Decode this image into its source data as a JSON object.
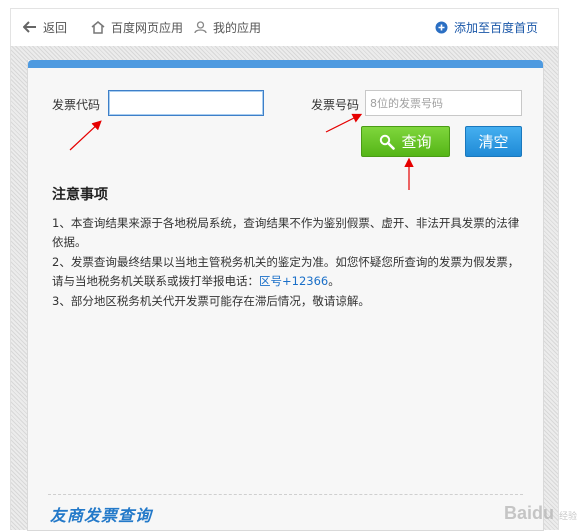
{
  "topbar": {
    "back_label": "返回",
    "baidu_apps_label": "百度网页应用",
    "my_apps_label": "我的应用",
    "add_home_label": "添加至百度首页"
  },
  "form": {
    "code_label": "发票代码",
    "code_value": "",
    "number_label": "发票号码",
    "number_placeholder": "8位的发票号码",
    "query_label": "查询",
    "clear_label": "清空"
  },
  "notice": {
    "title": "注意事项",
    "item1": "1、本查询结果来源于各地税局系统，查询结果不作为鉴别假票、虚开、非法开具发票的法律依据。",
    "item2_pre": "2、发票查询最终结果以当地主管税务机关的鉴定为准。如您怀疑您所查询的发票为假发票，请与当地税务机关联系或拨打举报电话：",
    "item2_phone": "区号+12366",
    "item2_post": "。",
    "item3": "3、部分地区税务机关代开发票可能存在滞后情况，敬请谅解。"
  },
  "footer": {
    "logo_text": "友商发票查询"
  },
  "watermark": {
    "brand": "Baidu",
    "sub": "经验"
  },
  "colors": {
    "accent_blue": "#4e9ae0",
    "query_green": "#55b517",
    "clear_blue": "#1f8ad6",
    "annotation_red": "#e60000"
  }
}
